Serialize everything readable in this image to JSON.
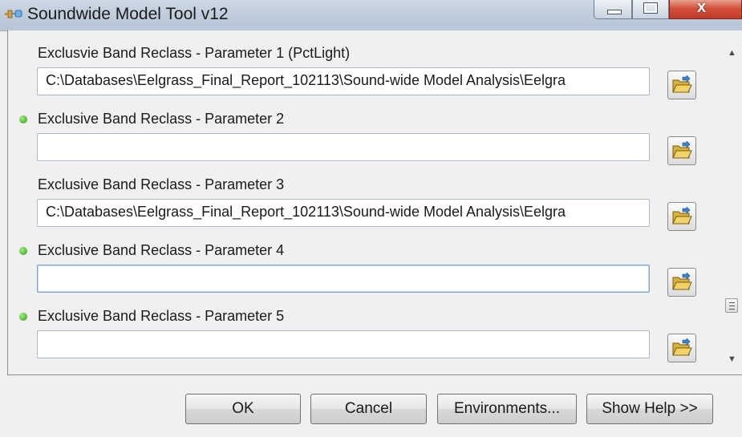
{
  "window": {
    "title": "Soundwide Model Tool v12",
    "controls": {
      "close_glyph": "x"
    }
  },
  "parameters": [
    {
      "label": "Exclusvie Band Reclass - Parameter 1 (PctLight)",
      "value": "C:\\Databases\\Eelgrass_Final_Report_102113\\Sound-wide Model Analysis\\Eelgra",
      "required_dot": false
    },
    {
      "label": "Exclusive Band Reclass - Parameter 2",
      "value": "",
      "required_dot": true
    },
    {
      "label": "Exclusive Band Reclass - Parameter 3",
      "value": "C:\\Databases\\Eelgrass_Final_Report_102113\\Sound-wide Model Analysis\\Eelgra",
      "required_dot": false
    },
    {
      "label": "Exclusive Band Reclass - Parameter 4",
      "value": "",
      "required_dot": true
    },
    {
      "label": "Exclusive Band Reclass - Parameter 5",
      "value": "",
      "required_dot": true
    }
  ],
  "icons": {
    "app": "model-tool-icon",
    "browse": "folder-open-icon",
    "required": "green-dot-icon"
  },
  "scrollbar": {
    "up": "▲",
    "down": "▼"
  },
  "buttons": {
    "ok": "OK",
    "cancel": "Cancel",
    "environments": "Environments...",
    "show_help": "Show Help >>"
  },
  "colors": {
    "required_dot": "#2e9a16",
    "close_button": "#c0392b",
    "folder": "#e8c24a"
  }
}
